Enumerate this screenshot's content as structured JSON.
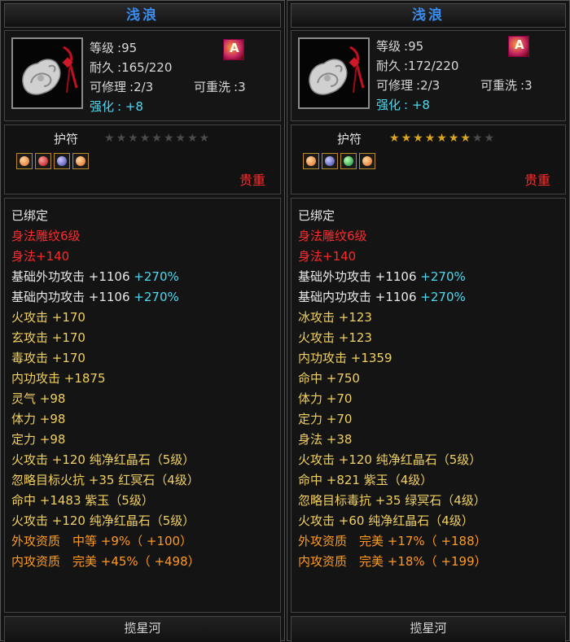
{
  "panels": [
    {
      "title": "浅浪",
      "level_label": "等级",
      "level_value": ":95",
      "durability_label": "耐久",
      "durability_value": ":165/220",
      "repair_label": "可修理",
      "repair_value": ":2/3",
      "rewash_label": "可重洗",
      "rewash_value": ":3",
      "enhance_label": "强化",
      "enhance_value": ": +8",
      "badge_glyph": "A",
      "talisman_label": "护符",
      "stars_filled": 0,
      "stars_total": 9,
      "gems": [
        "orange",
        "red",
        "purple",
        "orange"
      ],
      "precious_label": "贵重",
      "attrs": [
        {
          "text": "已绑定",
          "color": "white"
        },
        {
          "text": "身法雕纹6级",
          "color": "red"
        },
        {
          "text": "身法+140",
          "color": "red"
        },
        {
          "text": "基础外功攻击 +1106",
          "color": "light",
          "extra": " +270%"
        },
        {
          "text": "基础内功攻击 +1106",
          "color": "light",
          "extra": " +270%"
        },
        {
          "text": "火攻击 +170",
          "color": "yellow"
        },
        {
          "text": "玄攻击 +170",
          "color": "yellow"
        },
        {
          "text": "毒攻击 +170",
          "color": "yellow"
        },
        {
          "text": "内功攻击 +1875",
          "color": "yellow"
        },
        {
          "text": "灵气 +98",
          "color": "yellow"
        },
        {
          "text": "体力 +98",
          "color": "yellow"
        },
        {
          "text": "定力 +98",
          "color": "yellow"
        },
        {
          "text": "火攻击 +120 纯净红晶石（5级）",
          "color": "yellow"
        },
        {
          "text": "忽略目标火抗 +35 红冥石（4级）",
          "color": "yellow"
        },
        {
          "text": "命中 +1483 紫玉（5级）",
          "color": "yellow"
        },
        {
          "text": "火攻击 +120 纯净红晶石（5级）",
          "color": "yellow"
        },
        {
          "text": "外攻资质　中等 +9%（ +100）",
          "color": "orange"
        },
        {
          "text": "内攻资质　完美 +45%（ +498）",
          "color": "orange"
        }
      ],
      "footer": "揽星河"
    },
    {
      "title": "浅浪",
      "level_label": "等级",
      "level_value": ":95",
      "durability_label": "耐久",
      "durability_value": ":172/220",
      "repair_label": "可修理",
      "repair_value": ":2/3",
      "rewash_label": "可重洗",
      "rewash_value": ":3",
      "enhance_label": "强化",
      "enhance_value": ": +8",
      "badge_glyph": "A",
      "talisman_label": "护符",
      "stars_filled": 7,
      "stars_total": 9,
      "gems": [
        "orange",
        "purple",
        "green",
        "orange"
      ],
      "precious_label": "贵重",
      "attrs": [
        {
          "text": "已绑定",
          "color": "white"
        },
        {
          "text": "身法雕纹6级",
          "color": "red"
        },
        {
          "text": "身法+140",
          "color": "red"
        },
        {
          "text": "基础外功攻击 +1106",
          "color": "light",
          "extra": " +270%"
        },
        {
          "text": "基础内功攻击 +1106",
          "color": "light",
          "extra": " +270%"
        },
        {
          "text": "冰攻击 +123",
          "color": "yellow"
        },
        {
          "text": "火攻击 +123",
          "color": "yellow"
        },
        {
          "text": "内功攻击 +1359",
          "color": "yellow"
        },
        {
          "text": "命中 +750",
          "color": "yellow"
        },
        {
          "text": "体力 +70",
          "color": "yellow"
        },
        {
          "text": "定力 +70",
          "color": "yellow"
        },
        {
          "text": "身法 +38",
          "color": "yellow"
        },
        {
          "text": "火攻击 +120 纯净红晶石（5级）",
          "color": "yellow"
        },
        {
          "text": "命中 +821 紫玉（4级）",
          "color": "yellow"
        },
        {
          "text": "忽略目标毒抗 +35 绿冥石（4级）",
          "color": "yellow"
        },
        {
          "text": "火攻击 +60 纯净红晶石（4级）",
          "color": "yellow"
        },
        {
          "text": "外攻资质　完美 +17%（ +188）",
          "color": "orange"
        },
        {
          "text": "内攻资质　完美 +18%（ +199）",
          "color": "orange"
        }
      ],
      "footer": "揽星河"
    }
  ]
}
